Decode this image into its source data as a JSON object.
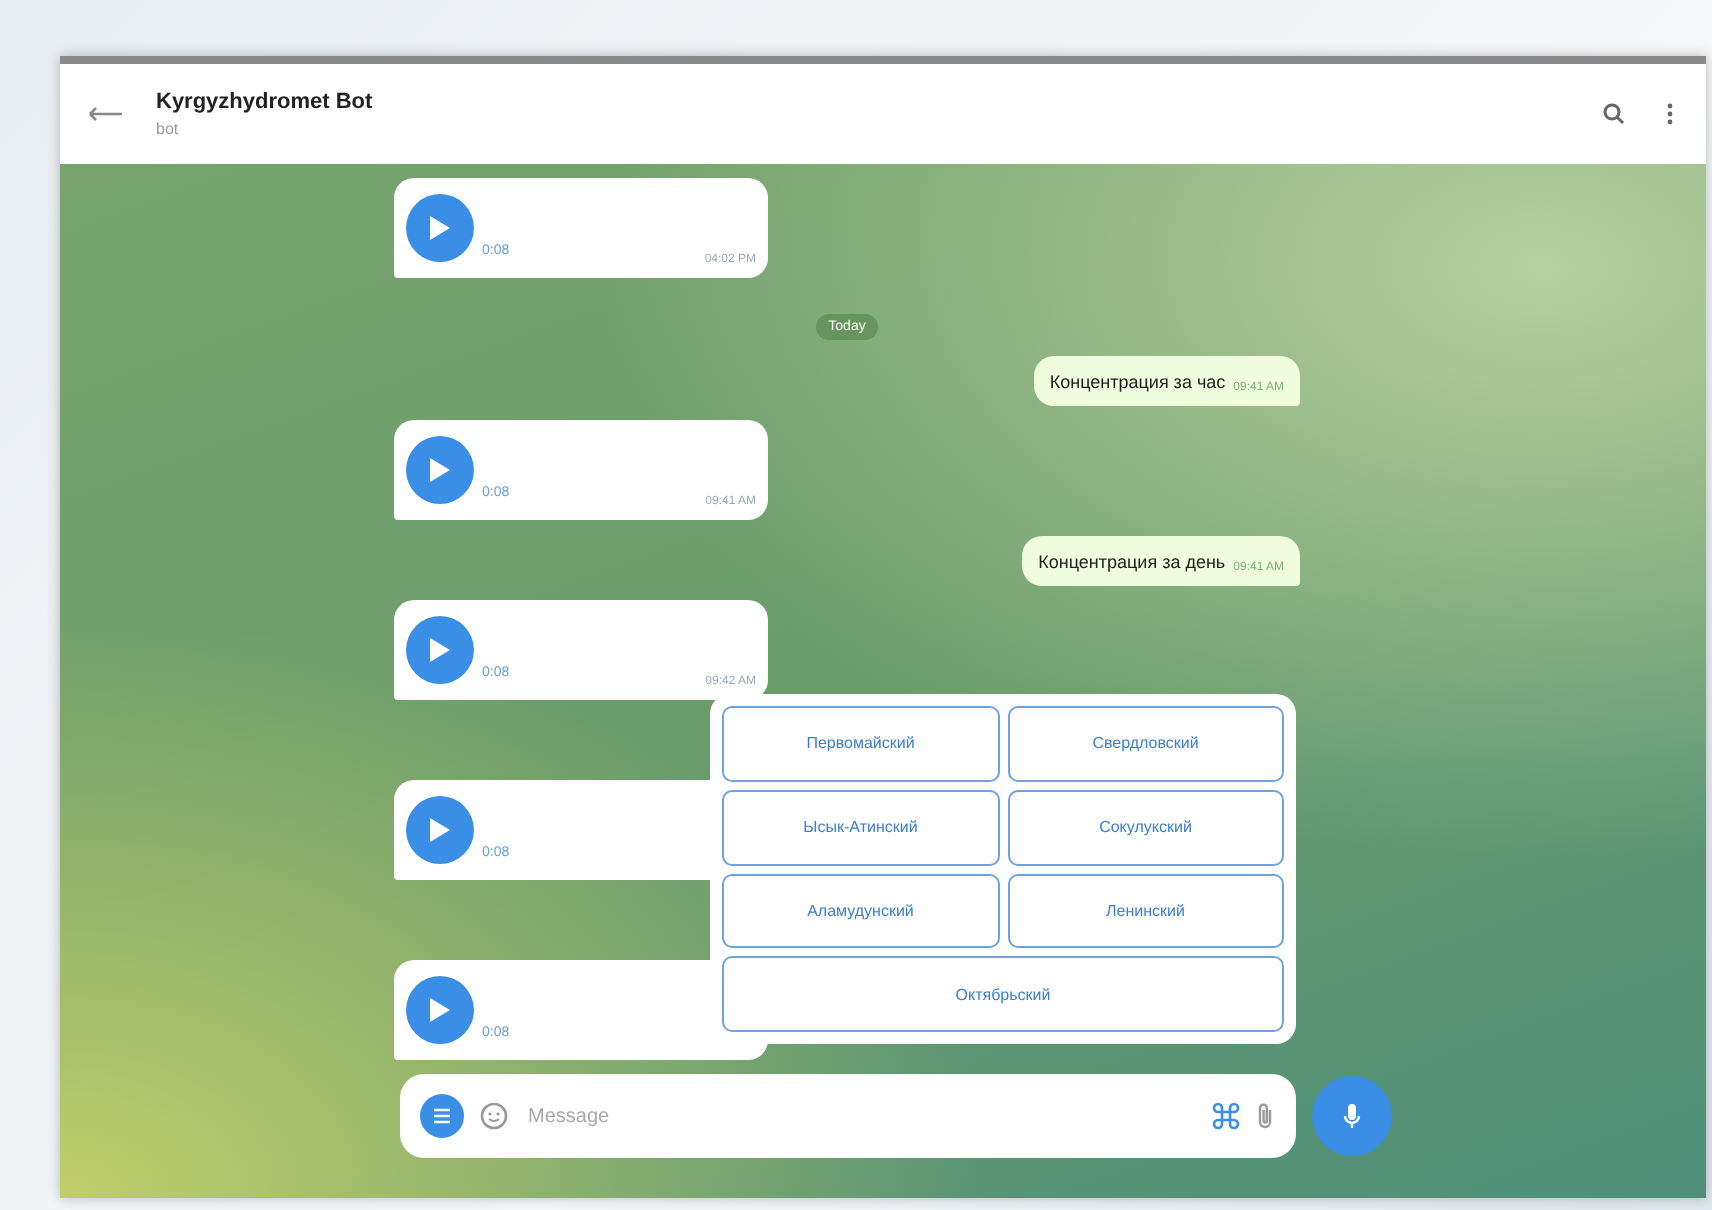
{
  "header": {
    "title": "Kyrgyzhydromet Bot",
    "subtitle": "bot"
  },
  "messages": [
    {
      "kind": "voice",
      "duration": "0:08",
      "time": "04:02 PM"
    },
    {
      "kind": "date",
      "text": "Today"
    },
    {
      "kind": "outgoing",
      "text": "Концентрация за час",
      "time": "09:41 AM"
    },
    {
      "kind": "voice",
      "duration": "0:08",
      "time": "09:41 AM"
    },
    {
      "kind": "outgoing",
      "text": "Концентрация за день",
      "time": "09:41 AM"
    },
    {
      "kind": "voice",
      "duration": "0:08",
      "time": "09:42 AM"
    },
    {
      "kind": "voice",
      "duration": "0:08"
    },
    {
      "kind": "voice",
      "duration": "0:08"
    }
  ],
  "keyboard": [
    [
      "Первомайский",
      "Свердловский"
    ],
    [
      "Ысык-Атинский",
      "Сокулукский"
    ],
    [
      "Аламудунский",
      "Ленинский"
    ],
    [
      "Октябрьский"
    ]
  ],
  "composer": {
    "placeholder": "Message"
  }
}
